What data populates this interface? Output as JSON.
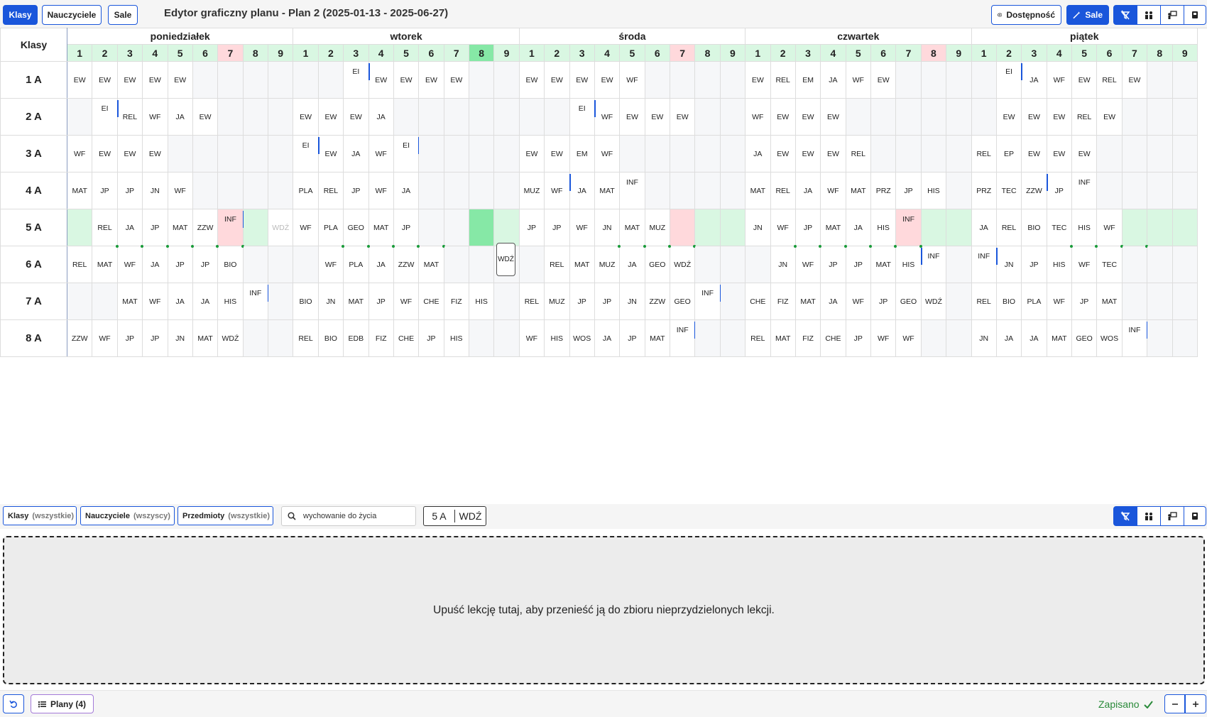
{
  "toolbar": {
    "tab_classes": "Klasy",
    "tab_teachers": "Nauczyciele",
    "tab_rooms": "Sale",
    "title": "Edytor graficzny planu - Plan 2 (2025-01-13 - 2025-06-27)",
    "availability_label": "Dostępność",
    "rooms_label": "Sale"
  },
  "grid": {
    "corner": "Klasy",
    "days": [
      "poniedziałek",
      "wtorek",
      "środa",
      "czwartek",
      "piątek"
    ],
    "periods": [
      "1",
      "2",
      "3",
      "4",
      "5",
      "6",
      "7",
      "8",
      "9"
    ],
    "classes": [
      "1 A",
      "2 A",
      "3 A",
      "4 A",
      "5 A",
      "6 A",
      "7 A",
      "8 A"
    ]
  },
  "floating_card": "WDŹ",
  "filters": {
    "classes": "Klasy",
    "classes_all": "(wszystkie)",
    "teachers": "Nauczyciele",
    "teachers_all": "(wszyscy)",
    "subjects": "Przedmioty",
    "subjects_all": "(wszystkie)",
    "search_value": "wychowanie do życia",
    "badge_class": "5 A",
    "badge_subject": "WDŹ"
  },
  "dropzone_text": "Upuść lekcję tutaj, aby przenieść ją do zbioru nieprzydzielonych lekcji.",
  "bottom": {
    "plans_label": "Plany (4)",
    "status": "Zapisano"
  },
  "colors": {
    "accent": "#1a56db",
    "free_slot": "#d9f7e2",
    "selected_slot": "#86e8a6",
    "conflict_slot": "#ffd9dc",
    "saved": "#2a8a3a"
  },
  "icons": [
    "filter-off-icon",
    "people-icon",
    "teacher-icon",
    "room-icon",
    "eye-icon",
    "wand-icon",
    "undo-icon",
    "list-icon",
    "check-icon",
    "minus-icon",
    "plus-icon",
    "search-icon"
  ],
  "schedule": {
    "1 A": [
      "EW",
      "EW",
      "EW",
      "EW",
      "EW",
      "",
      "",
      "",
      "",
      "",
      "",
      "EI",
      "EW",
      "EW",
      "EW",
      "EW",
      "",
      "",
      "EW",
      "EW",
      "EW",
      "EW",
      "WF",
      "",
      "",
      "",
      "",
      "EW",
      "REL",
      "EM",
      "JA",
      "WF",
      "EW",
      "",
      "",
      "",
      "",
      "EI",
      "JA",
      "WF",
      "EW",
      "REL",
      "EW",
      "",
      ""
    ],
    "2 A": [
      "",
      "EI",
      "REL",
      "WF",
      "JA",
      "EW",
      "",
      "",
      "",
      "EW",
      "EW",
      "EW",
      "JA",
      "",
      "",
      "",
      "",
      "",
      "",
      "",
      "EI",
      "WF",
      "EW",
      "EW",
      "EW",
      "",
      "",
      "WF",
      "EW",
      "EW",
      "EW",
      "",
      "",
      "",
      "",
      "",
      "",
      "EW",
      "EW",
      "EW",
      "REL",
      "EW",
      "",
      "",
      ""
    ],
    "3 A": [
      "WF",
      "EW",
      "EW",
      "EW",
      "",
      "",
      "",
      "",
      "",
      "EI",
      "EW",
      "JA",
      "WF",
      "EI",
      "",
      "",
      "",
      "",
      "EW",
      "EW",
      "EM",
      "WF",
      "",
      "",
      "",
      "",
      "",
      "JA",
      "EW",
      "EW",
      "EW",
      "REL",
      "",
      "",
      "",
      "",
      "REL",
      "EP",
      "EW",
      "EW",
      "EW",
      "",
      "",
      "",
      ""
    ],
    "4 A": [
      "MAT",
      "JP",
      "JP",
      "JN",
      "WF",
      "",
      "",
      "",
      "",
      "PLA",
      "REL",
      "JP",
      "WF",
      "JA",
      "",
      "",
      "",
      "",
      "MUZ",
      "WF",
      "JA",
      "MAT",
      "INF",
      "",
      "",
      "",
      "",
      "MAT",
      "REL",
      "JA",
      "WF",
      "MAT",
      "PRZ",
      "JP",
      "HIS",
      "",
      "PRZ",
      "TEC",
      "ZZW",
      "JP",
      "INF",
      "",
      "",
      "",
      ""
    ],
    "5 A": [
      "",
      "REL",
      "JA",
      "JP",
      "MAT",
      "ZZW",
      "INF",
      "",
      "WDŹ",
      "WF",
      "PLA",
      "GEO",
      "MAT",
      "JP",
      "",
      "",
      "",
      "",
      "JP",
      "JP",
      "WF",
      "JN",
      "MAT",
      "MUZ",
      "",
      "",
      "",
      "JN",
      "WF",
      "JP",
      "MAT",
      "JA",
      "HIS",
      "INF",
      "",
      "",
      "JA",
      "REL",
      "BIO",
      "TEC",
      "HIS",
      "WF",
      "",
      "",
      ""
    ],
    "6 A": [
      "REL",
      "MAT",
      "WF",
      "JA",
      "JP",
      "JP",
      "BIO",
      "",
      "",
      "",
      "WF",
      "PLA",
      "JA",
      "ZZW",
      "MAT",
      "",
      "",
      "",
      "",
      "REL",
      "MAT",
      "MUZ",
      "JA",
      "GEO",
      "WDŹ",
      "",
      "",
      "",
      "JN",
      "WF",
      "JP",
      "JP",
      "MAT",
      "HIS",
      "INF",
      "",
      "INF",
      "JN",
      "JP",
      "HIS",
      "WF",
      "TEC",
      "",
      "",
      ""
    ],
    "7 A": [
      "",
      "",
      "MAT",
      "WF",
      "JA",
      "JA",
      "HIS",
      "INF",
      "",
      "BIO",
      "JN",
      "MAT",
      "JP",
      "WF",
      "CHE",
      "FIZ",
      "HIS",
      "",
      "REL",
      "MUZ",
      "JP",
      "JP",
      "JN",
      "ZZW",
      "GEO",
      "INF",
      "",
      "CHE",
      "FIZ",
      "MAT",
      "JA",
      "WF",
      "JP",
      "GEO",
      "WDŹ",
      "",
      "REL",
      "BIO",
      "PLA",
      "WF",
      "JP",
      "MAT",
      "",
      "",
      ""
    ],
    "8 A": [
      "ZZW",
      "WF",
      "JP",
      "JP",
      "JN",
      "MAT",
      "WDŹ",
      "",
      "",
      "REL",
      "BIO",
      "EDB",
      "FIZ",
      "CHE",
      "JP",
      "HIS",
      "",
      "",
      "WF",
      "HIS",
      "WOS",
      "JA",
      "JP",
      "MAT",
      "INF",
      "",
      "",
      "REL",
      "MAT",
      "FIZ",
      "CHE",
      "JP",
      "WF",
      "WF",
      "",
      "",
      "JN",
      "JA",
      "JA",
      "MAT",
      "GEO",
      "WOS",
      "INF",
      "",
      ""
    ]
  }
}
